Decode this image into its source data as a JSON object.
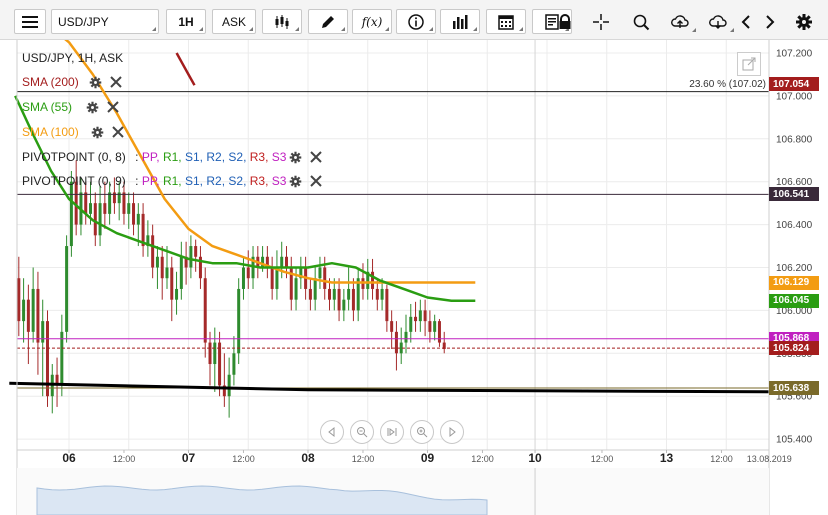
{
  "toolbar": {
    "symbol": "USD/JPY",
    "timeframe": "1H",
    "price_type": "ASK",
    "function_label": "f(x)"
  },
  "legend": {
    "title": "USD/JPY, 1H, ASK",
    "sma200": "SMA (200)",
    "sma55": "SMA (55)",
    "sma100": "SMA (100)",
    "pivot1": "PIVOTPOINT (0, 8)",
    "pivot2": "PIVOTPOINT (0, 9)",
    "pivot_sep": " : ",
    "pivot_parts": [
      "PP,",
      "R1,",
      "S1,",
      "R2,",
      "S2,",
      "R3,",
      "S3"
    ]
  },
  "fib_label": "23.60 % (107.02)",
  "price_tags": [
    {
      "value": "107.054",
      "price": 107.054,
      "color": "#a31d1d"
    },
    {
      "value": "106.541",
      "price": 106.541,
      "color": "#3a2a3a"
    },
    {
      "value": "106.129",
      "price": 106.129,
      "color": "#f39c12"
    },
    {
      "value": "106.045",
      "price": 106.045,
      "color": "#2a9d12"
    },
    {
      "value": "105.868",
      "price": 105.868,
      "color": "#c020c0"
    },
    {
      "value": "105.824",
      "price": 105.824,
      "color": "#a31d1d"
    },
    {
      "value": "105.638",
      "price": 105.638,
      "color": "#7a6a2a"
    }
  ],
  "colors": {
    "sma200": "#a31d1d",
    "sma55": "#2a9d12",
    "sma100": "#f39c12",
    "pp": "#c020c0",
    "r1": "#2a9d12",
    "s1": "#1f5fb5",
    "r2": "#1f5fb5",
    "s2": "#1f5fb5",
    "r3": "#c02020",
    "s3": "#c020c0",
    "up": "#2e8b2e",
    "down": "#a52a2a",
    "trendline": "#000000"
  },
  "chart_data": {
    "type": "line",
    "title": "USD/JPY, 1H, ASK",
    "y_ticks": [
      "107.200",
      "107.000",
      "106.800",
      "106.600",
      "106.400",
      "106.200",
      "106.000",
      "105.800",
      "105.600",
      "105.400"
    ],
    "x_ticks": [
      "06",
      "12:00",
      "07",
      "12:00",
      "08",
      "12:00",
      "09",
      "12:00",
      "10",
      "12:00",
      "13",
      "12:00",
      "13.08.2019"
    ],
    "ylim": [
      105.33,
      107.3
    ],
    "series": [
      {
        "name": "SMA (200)",
        "x": [
          0.9,
          0.95,
          1.0,
          1.05
        ],
        "values": [
          107.2,
          107.15,
          107.1,
          107.05
        ]
      },
      {
        "name": "SMA (100)",
        "x": [
          -0.45,
          -0.2,
          0.0,
          0.2,
          0.4,
          0.6,
          0.8,
          1.0,
          1.2,
          1.4,
          1.6,
          1.8,
          2.0,
          2.2,
          2.4,
          2.6,
          2.85,
          3.0,
          3.2,
          3.4
        ],
        "values": [
          107.42,
          107.34,
          107.25,
          107.1,
          106.92,
          106.72,
          106.52,
          106.38,
          106.3,
          106.26,
          106.22,
          106.18,
          106.15,
          106.13,
          106.13,
          106.13,
          106.13,
          106.13,
          106.13,
          106.13
        ]
      },
      {
        "name": "SMA (55)",
        "x": [
          -0.45,
          -0.3,
          -0.15,
          0.0,
          0.2,
          0.4,
          0.6,
          0.8,
          1.0,
          1.2,
          1.4,
          1.6,
          1.8,
          2.0,
          2.2,
          2.4,
          2.6,
          2.85,
          3.0,
          3.2,
          3.4
        ],
        "values": [
          107.0,
          106.82,
          106.65,
          106.52,
          106.42,
          106.36,
          106.32,
          106.28,
          106.24,
          106.22,
          106.22,
          106.2,
          106.2,
          106.2,
          106.22,
          106.2,
          106.14,
          106.09,
          106.06,
          106.045,
          106.045
        ]
      }
    ],
    "levels": [
      {
        "label": "23.60 % (107.02)",
        "value": 107.02
      },
      {
        "value": 106.541
      },
      {
        "value": 105.868
      },
      {
        "value": 105.824
      },
      {
        "value": 105.638
      }
    ],
    "trendline": {
      "x": [
        -0.5,
        2.0,
        6.0
      ],
      "values": [
        105.66,
        105.63,
        105.62
      ]
    }
  }
}
